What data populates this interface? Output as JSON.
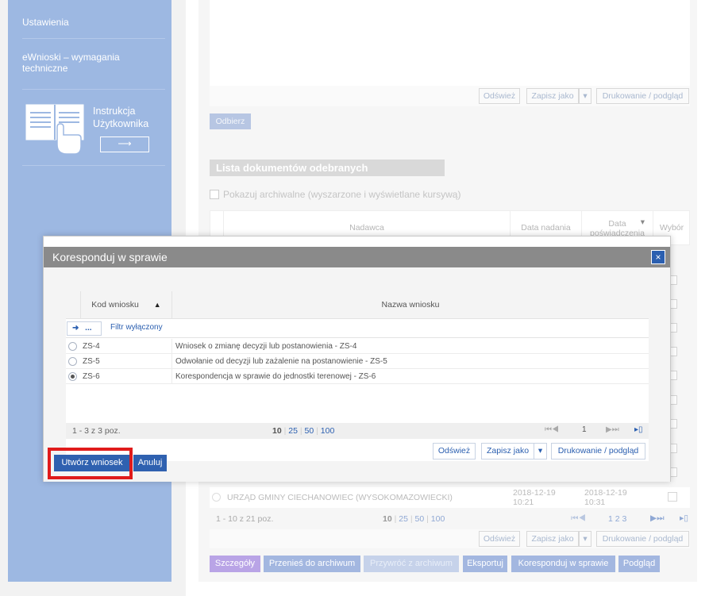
{
  "sidebar": {
    "settings": "Ustawienia",
    "requirements": "eWnioski – wymagania techniczne",
    "manual_title_line1": "Instrukcja",
    "manual_title_line2": "Użytkownika",
    "manual_arrow": "⟶"
  },
  "top_toolbar": {
    "refresh": "Odśwież",
    "save_as": "Zapisz jako",
    "print": "Drukowanie / podgląd",
    "receive": "Odbierz"
  },
  "received_list": {
    "title": "Lista dokumentów odebranych",
    "show_archived": "Pokazuj archiwalne (wyszarzone i wyświetlane kursywą)",
    "columns": {
      "sender": "Nadawca",
      "send_date": "Data nadania",
      "cert_date": "Data poświadczenia",
      "choice": "Wybór"
    },
    "last_row": {
      "sender": "URZĄD GMINY CIECHANOWIEC (WYSOKOMAZOWIECKI)",
      "send_date_1": "2018-12-19",
      "send_date_2": "10:21",
      "cert_date_1": "2018-12-19",
      "cert_date_2": "10:31"
    },
    "pager": {
      "count": "1 - 10 z 21 poz.",
      "size_10": "10",
      "size_25": "25",
      "size_50": "50",
      "size_100": "100",
      "pages": "1 2 3"
    },
    "toolbar": {
      "refresh": "Odśwież",
      "save_as": "Zapisz jako",
      "print": "Drukowanie / podgląd"
    },
    "actions": {
      "details": "Szczegóły",
      "archive": "Przenieś do archiwum",
      "restore": "Przywróć z archiwum",
      "export": "Eksportuj",
      "correspond": "Koresponduj w sprawie",
      "preview": "Podgląd"
    }
  },
  "dialog": {
    "title": "Koresponduj w sprawie",
    "close": "×",
    "columns": {
      "code": "Kod wniosku",
      "name": "Nazwa wniosku"
    },
    "filter_button": "...",
    "filter_label": "Filtr wyłączony",
    "rows": [
      {
        "code": "ZS-4",
        "name": "Wniosek o zmianę decyzji lub postanowienia - ZS-4",
        "selected": false
      },
      {
        "code": "ZS-5",
        "name": "Odwołanie od decyzji lub zażalenie na postanowienie - ZS-5",
        "selected": false
      },
      {
        "code": "ZS-6",
        "name": "Korespondencja w sprawie do jednostki terenowej - ZS-6",
        "selected": true
      }
    ],
    "pager": {
      "count": "1 - 3 z 3 poz.",
      "size_10": "10",
      "size_25": "25",
      "size_50": "50",
      "size_100": "100",
      "page": "1"
    },
    "toolbar": {
      "refresh": "Odśwież",
      "save_as": "Zapisz jako",
      "print": "Drukowanie / podgląd"
    },
    "create": "Utwórz wniosek",
    "cancel": "Anuluj"
  },
  "colors": {
    "sidebar": "#9db8e2",
    "primary": "#2f61b0",
    "highlight": "#e01b1b"
  }
}
